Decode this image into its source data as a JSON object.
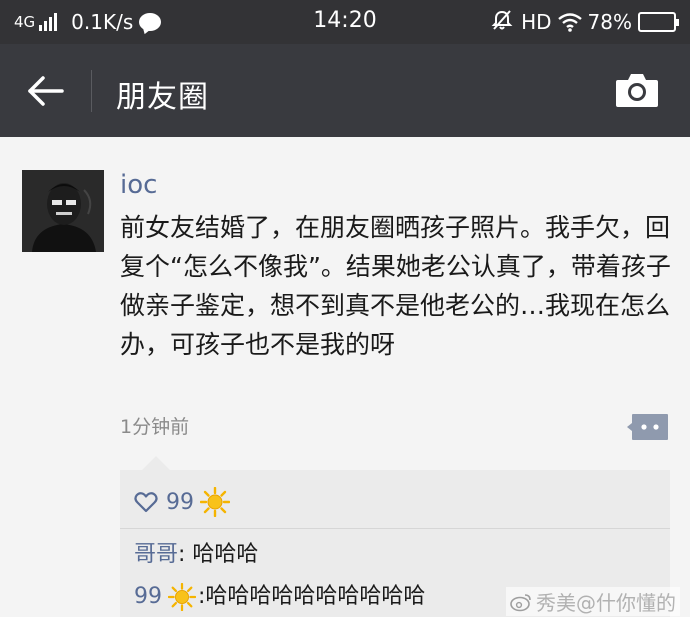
{
  "status_bar": {
    "network": "4G",
    "speed": "0.1K/s",
    "time": "14:20",
    "hd": "HD",
    "battery": "78%",
    "battery_level": 0.78
  },
  "nav": {
    "title": "朋友圈"
  },
  "post": {
    "username": "ioc",
    "text": "前女友结婚了，在朋友圈晒孩子照片。我手欠，回复个“怎么不像我”。结果她老公认真了，带着孩子做亲子鉴定，想不到真不是他老公的…我现在怎么办，可孩子也不是我的呀",
    "timestamp": "1分钟前"
  },
  "interactions": {
    "likes": "99",
    "comments": [
      {
        "name": "哥哥",
        "sep": ": ",
        "text": "哈哈哈"
      },
      {
        "name": "99",
        "sep": ": ",
        "text": "哈哈哈哈哈哈哈哈哈哈"
      }
    ]
  },
  "watermark": {
    "text": "秀美@什你懂的"
  },
  "colors": {
    "nav_bg": "#393a3f",
    "status_bg": "#333336",
    "link": "#576b95",
    "sun": "#f5b400"
  }
}
